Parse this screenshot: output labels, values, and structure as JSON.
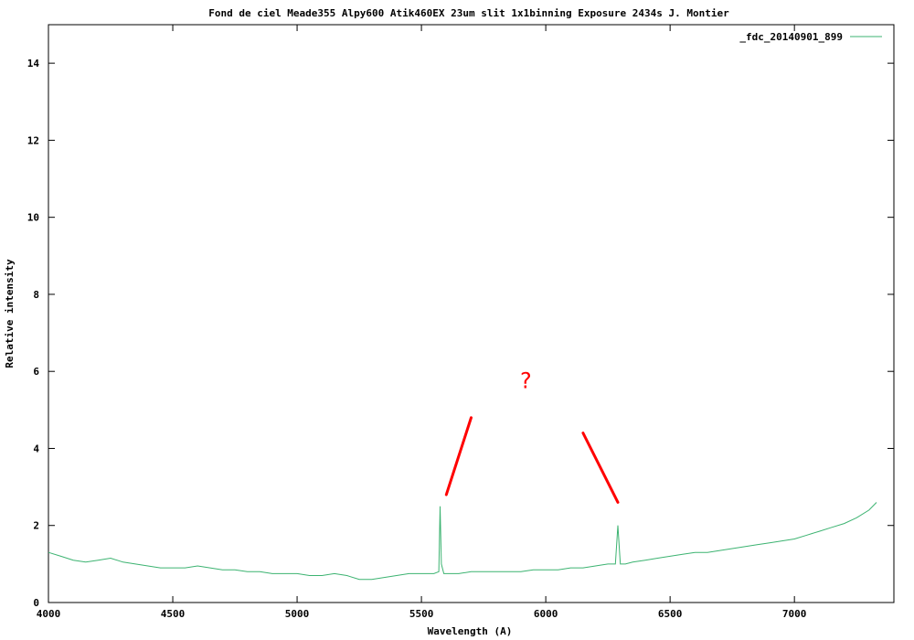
{
  "chart_data": {
    "type": "line",
    "title": "Fond de ciel Meade355 Alpy600 Atik460EX 23um slit 1x1binning Exposure 2434s J. Montier",
    "xlabel": "Wavelength (A)",
    "ylabel": "Relative intensity",
    "xlim": [
      4000,
      7400
    ],
    "ylim": [
      0,
      15
    ],
    "xticks": [
      4000,
      4500,
      5000,
      5500,
      6000,
      6500,
      7000
    ],
    "yticks": [
      0,
      2,
      4,
      6,
      8,
      10,
      12,
      14
    ],
    "grid": false,
    "legend_position": "top-right",
    "series": [
      {
        "name": "_fdc_20140901_899",
        "color": "#3cb371",
        "x": [
          4000,
          4050,
          4100,
          4150,
          4200,
          4250,
          4300,
          4350,
          4400,
          4450,
          4500,
          4550,
          4600,
          4650,
          4700,
          4750,
          4800,
          4850,
          4900,
          4950,
          5000,
          5050,
          5100,
          5150,
          5200,
          5250,
          5300,
          5350,
          5400,
          5450,
          5500,
          5550,
          5570,
          5575,
          5580,
          5590,
          5650,
          5700,
          5750,
          5800,
          5850,
          5900,
          5950,
          6000,
          6050,
          6100,
          6150,
          6200,
          6250,
          6280,
          6290,
          6300,
          6320,
          6350,
          6400,
          6450,
          6500,
          6550,
          6600,
          6650,
          6700,
          6750,
          6800,
          6850,
          6900,
          6950,
          7000,
          7050,
          7100,
          7150,
          7200,
          7250,
          7300,
          7330
        ],
        "y": [
          1.3,
          1.2,
          1.1,
          1.05,
          1.1,
          1.15,
          1.05,
          1.0,
          0.95,
          0.9,
          0.9,
          0.9,
          0.95,
          0.9,
          0.85,
          0.85,
          0.8,
          0.8,
          0.75,
          0.75,
          0.75,
          0.7,
          0.7,
          0.75,
          0.7,
          0.6,
          0.6,
          0.65,
          0.7,
          0.75,
          0.75,
          0.75,
          0.8,
          2.5,
          1.0,
          0.75,
          0.75,
          0.8,
          0.8,
          0.8,
          0.8,
          0.8,
          0.85,
          0.85,
          0.85,
          0.9,
          0.9,
          0.95,
          1.0,
          1.0,
          2.0,
          1.0,
          1.0,
          1.05,
          1.1,
          1.15,
          1.2,
          1.25,
          1.3,
          1.3,
          1.35,
          1.4,
          1.45,
          1.5,
          1.55,
          1.6,
          1.65,
          1.75,
          1.85,
          1.95,
          2.05,
          2.2,
          2.4,
          2.6
        ]
      }
    ],
    "annotations": [
      {
        "type": "text",
        "text": "?",
        "x": 5920,
        "y": 5.8,
        "color": "#ff0000"
      },
      {
        "type": "line",
        "x1": 5600,
        "y1": 2.8,
        "x2": 5700,
        "y2": 4.8,
        "color": "#ff0000"
      },
      {
        "type": "line",
        "x1": 6150,
        "y1": 4.4,
        "x2": 6290,
        "y2": 2.6,
        "color": "#ff0000"
      }
    ]
  }
}
